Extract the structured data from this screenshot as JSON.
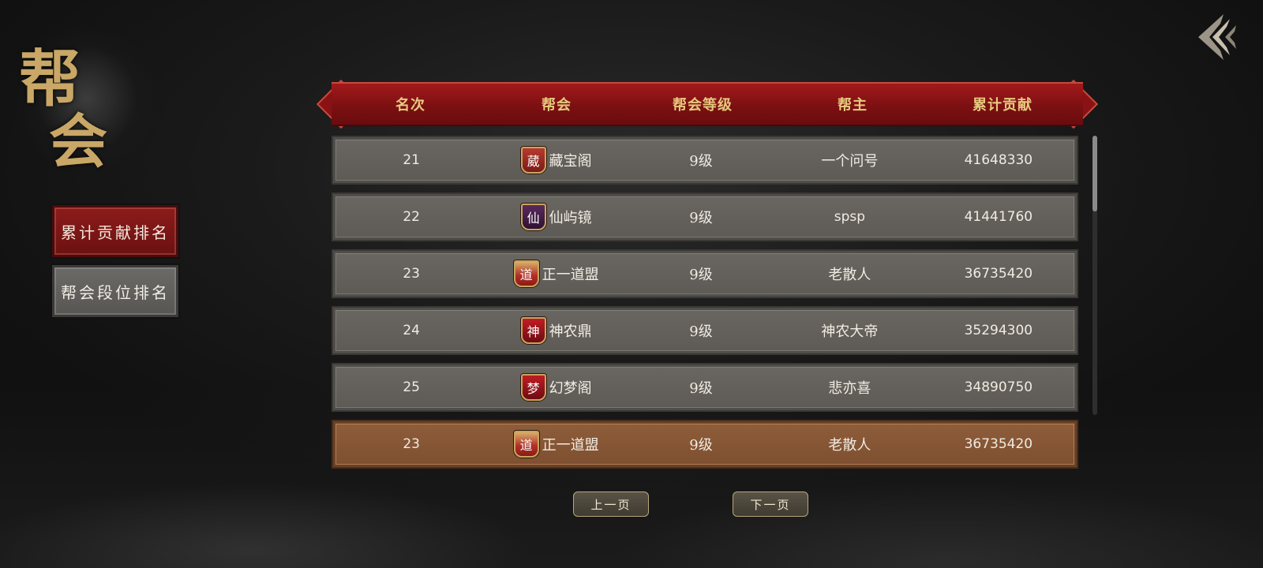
{
  "title": {
    "char1": "帮",
    "char2": "会"
  },
  "side_tabs": [
    {
      "label": "累计贡献排名",
      "active": true
    },
    {
      "label": "帮会段位排名",
      "active": false
    }
  ],
  "table": {
    "headers": [
      "名次",
      "帮会",
      "帮会等级",
      "帮主",
      "累计贡献"
    ],
    "rows": [
      {
        "rank": "21",
        "emblem": "葳",
        "guild": "藏宝阁",
        "level": "9级",
        "leader": "一个问号",
        "total": "41648330"
      },
      {
        "rank": "22",
        "emblem": "仙",
        "guild": "仙屿镜",
        "level": "9级",
        "leader": "spsp",
        "total": "41441760"
      },
      {
        "rank": "23",
        "emblem": "道",
        "guild": "正一道盟",
        "level": "9级",
        "leader": "老散人",
        "total": "36735420"
      },
      {
        "rank": "24",
        "emblem": "神",
        "guild": "神农鼎",
        "level": "9级",
        "leader": "神农大帝",
        "total": "35294300"
      },
      {
        "rank": "25",
        "emblem": "梦",
        "guild": "幻梦阁",
        "level": "9级",
        "leader": "悲亦喜",
        "total": "34890750"
      }
    ],
    "my_row": {
      "rank": "23",
      "emblem": "道",
      "guild": "正一道盟",
      "level": "9级",
      "leader": "老散人",
      "total": "36735420"
    }
  },
  "pagination": {
    "prev_label": "上一页",
    "next_label": "下一页"
  },
  "colors": {
    "accent_red": "#8e1c1c",
    "gold_text": "#e7c97e",
    "row_gray": "#625f5a",
    "my_row_orange": "#855536"
  },
  "icons": {
    "back": "back-arrow-icon"
  }
}
